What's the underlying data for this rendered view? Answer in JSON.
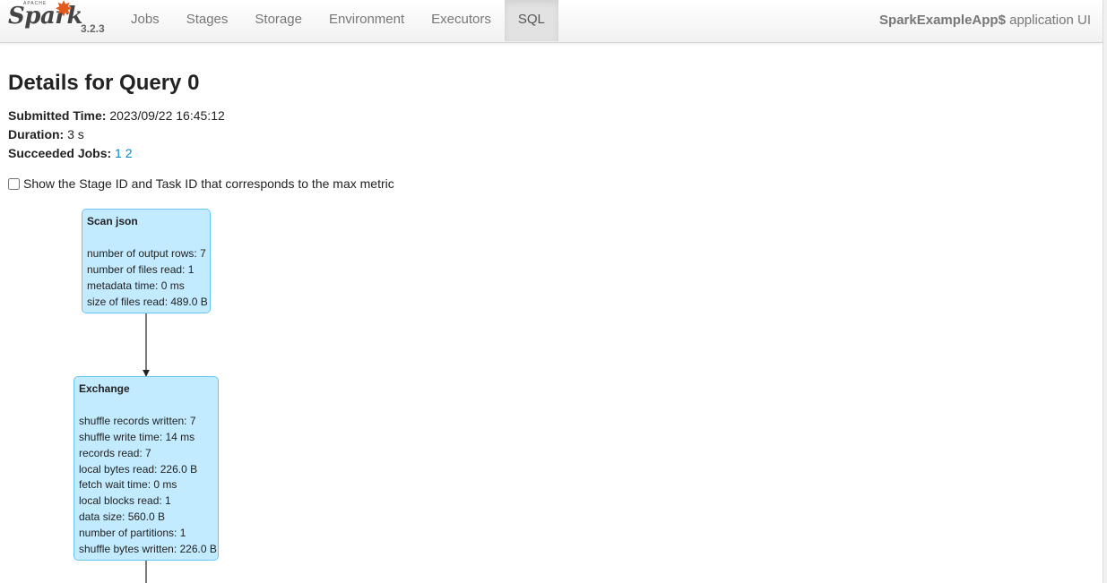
{
  "navbar": {
    "logo_apache": "APACHE",
    "logo_word": "Spark",
    "version": "3.2.3",
    "tabs": [
      {
        "label": "Jobs"
      },
      {
        "label": "Stages"
      },
      {
        "label": "Storage"
      },
      {
        "label": "Environment"
      },
      {
        "label": "Executors"
      },
      {
        "label": "SQL"
      }
    ],
    "active_tab": "SQL",
    "app_name": "SparkExampleApp$",
    "app_suffix": "application UI"
  },
  "page": {
    "title": "Details for Query 0",
    "submitted_label": "Submitted Time:",
    "submitted_value": "2023/09/22 16:45:12",
    "duration_label": "Duration:",
    "duration_value": "3 s",
    "jobs_label": "Succeeded Jobs:",
    "jobs": [
      "1",
      "2"
    ],
    "checkbox_label": "Show the Stage ID and Task ID that corresponds to the max metric",
    "checkbox_checked": false
  },
  "plan": {
    "nodes": [
      {
        "title": "Scan json",
        "metrics": [
          "number of output rows: 7",
          "number of files read: 1",
          "metadata time: 0 ms",
          "size of files read: 489.0 B"
        ]
      },
      {
        "title": "Exchange",
        "metrics": [
          "shuffle records written: 7",
          "shuffle write time: 14 ms",
          "records read: 7",
          "local bytes read: 226.0 B",
          "fetch wait time: 0 ms",
          "local blocks read: 1",
          "data size: 560.0 B",
          "number of partitions: 1",
          "shuffle bytes written: 226.0 B"
        ]
      }
    ]
  },
  "colors": {
    "node_fill": "#c3ebff",
    "node_border": "#68c7f2",
    "link": "#0088cc",
    "spark_orange": "#e25a1c"
  }
}
